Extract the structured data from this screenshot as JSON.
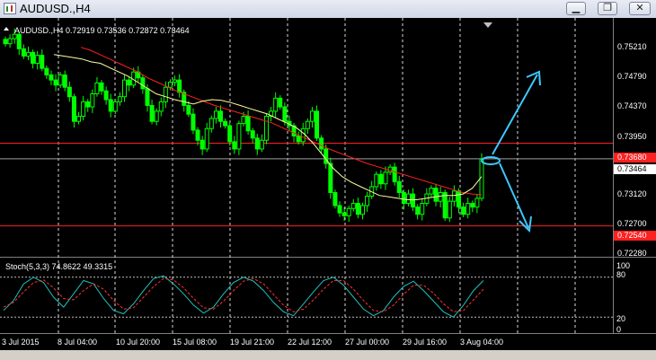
{
  "window": {
    "title": "AUDUSD.,H4"
  },
  "controls": {
    "minimize": "▁",
    "restore": "❐",
    "close": "✕"
  },
  "chart_header": {
    "text": "AUDUSD.,H4  0.72919 0.73536 0.72872 0.73464"
  },
  "price_axis": {
    "ticks": [
      "0.75210",
      "0.74790",
      "0.74370",
      "0.73950",
      "0.73120",
      "0.72700",
      "0.72280"
    ]
  },
  "level_labels": {
    "upper": "0.73680",
    "current": "0.73464",
    "lower": "0.72540"
  },
  "stoch": {
    "label": "Stoch(5,3,3) 74.8622 49.3315",
    "ticks": [
      "100",
      "80",
      "20",
      "0"
    ]
  },
  "time_axis": {
    "labels": [
      "3 Jul 2015",
      "8 Jul 04:00",
      "10 Jul 20:00",
      "15 Jul 08:00",
      "19 Jul 21:00",
      "22 Jul 12:00",
      "27 Jul 00:00",
      "29 Jul 16:00",
      "3 Aug 04:00"
    ]
  },
  "colors": {
    "bg": "#000000",
    "candle": "#00ff00",
    "ma_slow": "#ff2020",
    "ma_fast": "#ffffa0",
    "level": "#ff2020",
    "arrow": "#3ec8ff",
    "stoch_main": "#20c0c0",
    "stoch_signal": "#ff3030"
  },
  "chart_data": {
    "type": "candlestick",
    "symbol": "AUDUSD.",
    "timeframe": "H4",
    "last_ohlc": {
      "open": 0.72919,
      "high": 0.73536,
      "low": 0.72872,
      "close": 0.73464
    },
    "price_range": [
      0.7214,
      0.7538
    ],
    "closes": [
      0.7505,
      0.7512,
      0.7518,
      0.7498,
      0.7488,
      0.7493,
      0.7478,
      0.7489,
      0.7471,
      0.7462,
      0.7455,
      0.7448,
      0.7462,
      0.7445,
      0.7432,
      0.7398,
      0.7405,
      0.7425,
      0.7418,
      0.7436,
      0.7451,
      0.744,
      0.7428,
      0.7412,
      0.7425,
      0.7432,
      0.7455,
      0.7448,
      0.7466,
      0.7458,
      0.7443,
      0.742,
      0.7398,
      0.7412,
      0.7425,
      0.7445,
      0.7452,
      0.7455,
      0.7438,
      0.742,
      0.7408,
      0.7386,
      0.7372,
      0.736,
      0.7388,
      0.7402,
      0.7412,
      0.7398,
      0.7392,
      0.737,
      0.736,
      0.7395,
      0.7405,
      0.7385,
      0.7375,
      0.736,
      0.7372,
      0.7405,
      0.7412,
      0.743,
      0.7418,
      0.7398,
      0.7392,
      0.7378,
      0.737,
      0.7388,
      0.7398,
      0.7412,
      0.7375,
      0.736,
      0.734,
      0.73,
      0.7282,
      0.7272,
      0.7268,
      0.7278,
      0.7285,
      0.727,
      0.7282,
      0.7295,
      0.7308,
      0.7325,
      0.7312,
      0.7328,
      0.7335,
      0.7315,
      0.73,
      0.7285,
      0.7298,
      0.728,
      0.727,
      0.7285,
      0.7298,
      0.7306,
      0.7288,
      0.73,
      0.7265,
      0.7288,
      0.7302,
      0.728,
      0.727,
      0.7285,
      0.728,
      0.7292,
      0.7346
    ],
    "ma_fast": [
      0.749,
      0.7488,
      0.7486,
      0.7484,
      0.748,
      0.7478,
      0.7472,
      0.7466,
      0.746,
      0.7452,
      0.7444,
      0.7436,
      0.7432,
      0.7428,
      0.7425,
      0.7422,
      0.7426,
      0.7428,
      0.7427,
      0.7424,
      0.742,
      0.7416,
      0.7412,
      0.7408,
      0.7402,
      0.7396,
      0.739,
      0.738,
      0.7366,
      0.735,
      0.7334,
      0.7322,
      0.7314,
      0.7308,
      0.7302,
      0.7296,
      0.7294,
      0.7292,
      0.729,
      0.729,
      0.7292,
      0.7294,
      0.7296,
      0.7296,
      0.7298,
      0.7306,
      0.7322
    ],
    "ma_slow": [
      0.75,
      0.7496,
      0.749,
      0.7484,
      0.7478,
      0.7472,
      0.7466,
      0.7458,
      0.7452,
      0.7446,
      0.744,
      0.7435,
      0.743,
      0.7425,
      0.742,
      0.7416,
      0.7412,
      0.7408,
      0.7404,
      0.74,
      0.7396,
      0.739,
      0.7384,
      0.7378,
      0.7372,
      0.7366,
      0.736,
      0.7355,
      0.735,
      0.7345,
      0.734,
      0.7336,
      0.7332,
      0.7328,
      0.7324,
      0.732,
      0.7316,
      0.7312,
      0.7308,
      0.7304,
      0.73,
      0.7298,
      0.7297
    ],
    "levels": {
      "upper": 0.7368,
      "current": 0.73464,
      "lower": 0.7254
    },
    "stoch_main": [
      30,
      45,
      70,
      80,
      72,
      50,
      35,
      55,
      75,
      70,
      48,
      30,
      25,
      40,
      60,
      78,
      82,
      70,
      55,
      38,
      26,
      35,
      55,
      72,
      80,
      74,
      60,
      42,
      28,
      22,
      40,
      58,
      75,
      80,
      68,
      50,
      32,
      22,
      30,
      50,
      66,
      74,
      60,
      44,
      28,
      20,
      38,
      60,
      75
    ],
    "stoch_signal": [
      35,
      42,
      58,
      72,
      76,
      64,
      48,
      46,
      60,
      70,
      62,
      45,
      32,
      34,
      50,
      66,
      78,
      76,
      64,
      48,
      34,
      32,
      44,
      60,
      74,
      78,
      70,
      54,
      38,
      28,
      32,
      46,
      62,
      75,
      75,
      62,
      45,
      30,
      28,
      38,
      54,
      68,
      68,
      56,
      40,
      28,
      30,
      46,
      62
    ],
    "stoch_range": [
      0,
      100
    ],
    "stoch_levels": [
      80,
      20
    ]
  }
}
